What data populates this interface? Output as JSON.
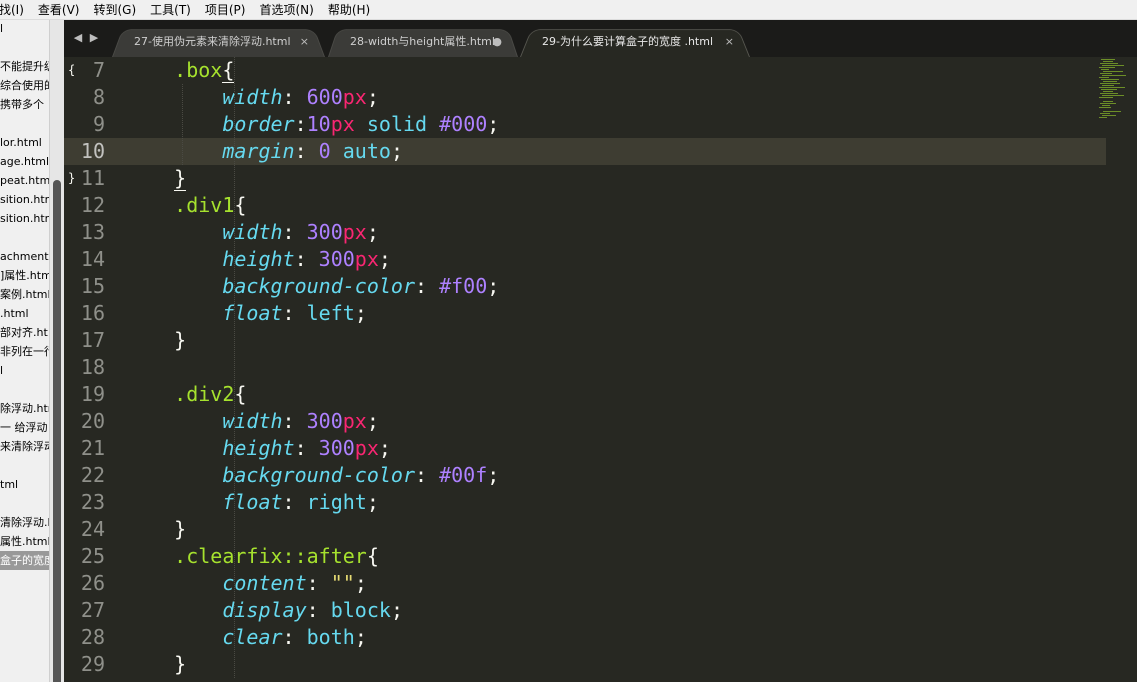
{
  "menu": [
    "找(I)",
    "查看(V)",
    "转到(G)",
    "工具(T)",
    "项目(P)",
    "首选项(N)",
    "帮助(H)"
  ],
  "sidebar": {
    "files": [
      {
        "label": "l",
        "selected": false
      },
      {
        "label": "",
        "selected": false
      },
      {
        "label": "不能提升级",
        "selected": false
      },
      {
        "label": "综合使用的",
        "selected": false
      },
      {
        "label": "携带多个",
        "selected": false
      },
      {
        "label": "",
        "selected": false
      },
      {
        "label": "lor.html",
        "selected": false
      },
      {
        "label": "age.html",
        "selected": false
      },
      {
        "label": "peat.html",
        "selected": false
      },
      {
        "label": "sition.htm",
        "selected": false
      },
      {
        "label": "sition.htm",
        "selected": false
      },
      {
        "label": "",
        "selected": false
      },
      {
        "label": "achment.",
        "selected": false
      },
      {
        "label": "]属性.htm",
        "selected": false
      },
      {
        "label": "案例.html",
        "selected": false
      },
      {
        "label": ".html",
        "selected": false
      },
      {
        "label": "部对齐.ht",
        "selected": false
      },
      {
        "label": "非列在一行",
        "selected": false
      },
      {
        "label": "l",
        "selected": false
      },
      {
        "label": "",
        "selected": false
      },
      {
        "label": "除浮动.htm",
        "selected": false
      },
      {
        "label": "一 给浮动",
        "selected": false
      },
      {
        "label": "来清除浮动",
        "selected": false
      },
      {
        "label": "",
        "selected": false
      },
      {
        "label": "tml",
        "selected": false
      },
      {
        "label": "",
        "selected": false
      },
      {
        "label": "清除浮动.h",
        "selected": false
      },
      {
        "label": "属性.html",
        "selected": false
      },
      {
        "label": "盒子的宽度",
        "selected": true
      }
    ]
  },
  "tabs": [
    {
      "label": "27-使用伪元素来清除浮动.html",
      "control": "×",
      "active": false
    },
    {
      "label": "28-width与height属性.html",
      "control": "●",
      "active": false
    },
    {
      "label": "29-为什么要计算盒子的宽度 .html",
      "control": "×",
      "active": true
    }
  ],
  "nav": {
    "back": "◀",
    "forward": "▶"
  },
  "editor": {
    "current_line": 10,
    "fold_open": "{",
    "fold_close": "}",
    "lines": [
      {
        "n": "7",
        "tokens": [
          [
            "    ",
            ""
          ],
          [
            ".box",
            "k-sel"
          ],
          [
            "{",
            "k-punc bracket-ul"
          ]
        ]
      },
      {
        "n": "8",
        "tokens": [
          [
            "        ",
            ""
          ],
          [
            "width",
            "k-prop"
          ],
          [
            ": ",
            "k-punc"
          ],
          [
            "600",
            "k-num"
          ],
          [
            "px",
            "k-unit"
          ],
          [
            ";",
            "k-punc"
          ]
        ]
      },
      {
        "n": "9",
        "tokens": [
          [
            "        ",
            ""
          ],
          [
            "border",
            "k-prop"
          ],
          [
            ":",
            "k-punc"
          ],
          [
            "10",
            "k-num"
          ],
          [
            "px",
            "k-unit"
          ],
          [
            " ",
            ""
          ],
          [
            "solid",
            "k-kw"
          ],
          [
            " ",
            ""
          ],
          [
            "#000",
            "k-num"
          ],
          [
            ";",
            "k-punc"
          ]
        ]
      },
      {
        "n": "10",
        "tokens": [
          [
            "        ",
            ""
          ],
          [
            "margin",
            "k-prop"
          ],
          [
            ": ",
            "k-punc"
          ],
          [
            "0",
            "k-num"
          ],
          [
            " ",
            ""
          ],
          [
            "auto",
            "k-kw"
          ],
          [
            ";",
            "k-punc"
          ]
        ]
      },
      {
        "n": "11",
        "tokens": [
          [
            "    ",
            ""
          ],
          [
            "}",
            "k-punc bracket-ul"
          ]
        ]
      },
      {
        "n": "12",
        "tokens": [
          [
            "    ",
            ""
          ],
          [
            ".div1",
            "k-sel"
          ],
          [
            "{",
            "k-punc"
          ]
        ]
      },
      {
        "n": "13",
        "tokens": [
          [
            "        ",
            ""
          ],
          [
            "width",
            "k-prop"
          ],
          [
            ": ",
            "k-punc"
          ],
          [
            "300",
            "k-num"
          ],
          [
            "px",
            "k-unit"
          ],
          [
            ";",
            "k-punc"
          ]
        ]
      },
      {
        "n": "14",
        "tokens": [
          [
            "        ",
            ""
          ],
          [
            "height",
            "k-prop"
          ],
          [
            ": ",
            "k-punc"
          ],
          [
            "300",
            "k-num"
          ],
          [
            "px",
            "k-unit"
          ],
          [
            ";",
            "k-punc"
          ]
        ]
      },
      {
        "n": "15",
        "tokens": [
          [
            "        ",
            ""
          ],
          [
            "background-color",
            "k-prop"
          ],
          [
            ": ",
            "k-punc"
          ],
          [
            "#f00",
            "k-num"
          ],
          [
            ";",
            "k-punc"
          ]
        ]
      },
      {
        "n": "16",
        "tokens": [
          [
            "        ",
            ""
          ],
          [
            "float",
            "k-prop"
          ],
          [
            ": ",
            "k-punc"
          ],
          [
            "left",
            "k-kw"
          ],
          [
            ";",
            "k-punc"
          ]
        ]
      },
      {
        "n": "17",
        "tokens": [
          [
            "    ",
            ""
          ],
          [
            "}",
            "k-punc"
          ]
        ]
      },
      {
        "n": "18",
        "tokens": []
      },
      {
        "n": "19",
        "tokens": [
          [
            "    ",
            ""
          ],
          [
            ".div2",
            "k-sel"
          ],
          [
            "{",
            "k-punc"
          ]
        ]
      },
      {
        "n": "20",
        "tokens": [
          [
            "        ",
            ""
          ],
          [
            "width",
            "k-prop"
          ],
          [
            ": ",
            "k-punc"
          ],
          [
            "300",
            "k-num"
          ],
          [
            "px",
            "k-unit"
          ],
          [
            ";",
            "k-punc"
          ]
        ]
      },
      {
        "n": "21",
        "tokens": [
          [
            "        ",
            ""
          ],
          [
            "height",
            "k-prop"
          ],
          [
            ": ",
            "k-punc"
          ],
          [
            "300",
            "k-num"
          ],
          [
            "px",
            "k-unit"
          ],
          [
            ";",
            "k-punc"
          ]
        ]
      },
      {
        "n": "22",
        "tokens": [
          [
            "        ",
            ""
          ],
          [
            "background-color",
            "k-prop"
          ],
          [
            ": ",
            "k-punc"
          ],
          [
            "#00f",
            "k-num"
          ],
          [
            ";",
            "k-punc"
          ]
        ]
      },
      {
        "n": "23",
        "tokens": [
          [
            "        ",
            ""
          ],
          [
            "float",
            "k-prop"
          ],
          [
            ": ",
            "k-punc"
          ],
          [
            "right",
            "k-kw"
          ],
          [
            ";",
            "k-punc"
          ]
        ]
      },
      {
        "n": "24",
        "tokens": [
          [
            "    ",
            ""
          ],
          [
            "}",
            "k-punc"
          ]
        ]
      },
      {
        "n": "25",
        "tokens": [
          [
            "    ",
            ""
          ],
          [
            ".clearfix::after",
            "k-sel"
          ],
          [
            "{",
            "k-punc"
          ]
        ]
      },
      {
        "n": "26",
        "tokens": [
          [
            "        ",
            ""
          ],
          [
            "content",
            "k-prop"
          ],
          [
            ": ",
            "k-punc"
          ],
          [
            "\"\"",
            "k-str"
          ],
          [
            ";",
            "k-punc"
          ]
        ]
      },
      {
        "n": "27",
        "tokens": [
          [
            "        ",
            ""
          ],
          [
            "display",
            "k-prop"
          ],
          [
            ": ",
            "k-punc"
          ],
          [
            "block",
            "k-kw"
          ],
          [
            ";",
            "k-punc"
          ]
        ]
      },
      {
        "n": "28",
        "tokens": [
          [
            "        ",
            ""
          ],
          [
            "clear",
            "k-prop"
          ],
          [
            ": ",
            "k-punc"
          ],
          [
            "both",
            "k-kw"
          ],
          [
            ";",
            "k-punc"
          ]
        ]
      },
      {
        "n": "29",
        "tokens": [
          [
            "    ",
            ""
          ],
          [
            "}",
            "k-punc"
          ]
        ]
      }
    ]
  },
  "colors": {
    "background": "#272822",
    "selector": "#a6e22e",
    "property": "#66d9ef",
    "number": "#ae81ff",
    "unit": "#f92672",
    "string": "#e6db74",
    "text": "#f8f8f2",
    "line_highlight": "#3e3d32"
  }
}
